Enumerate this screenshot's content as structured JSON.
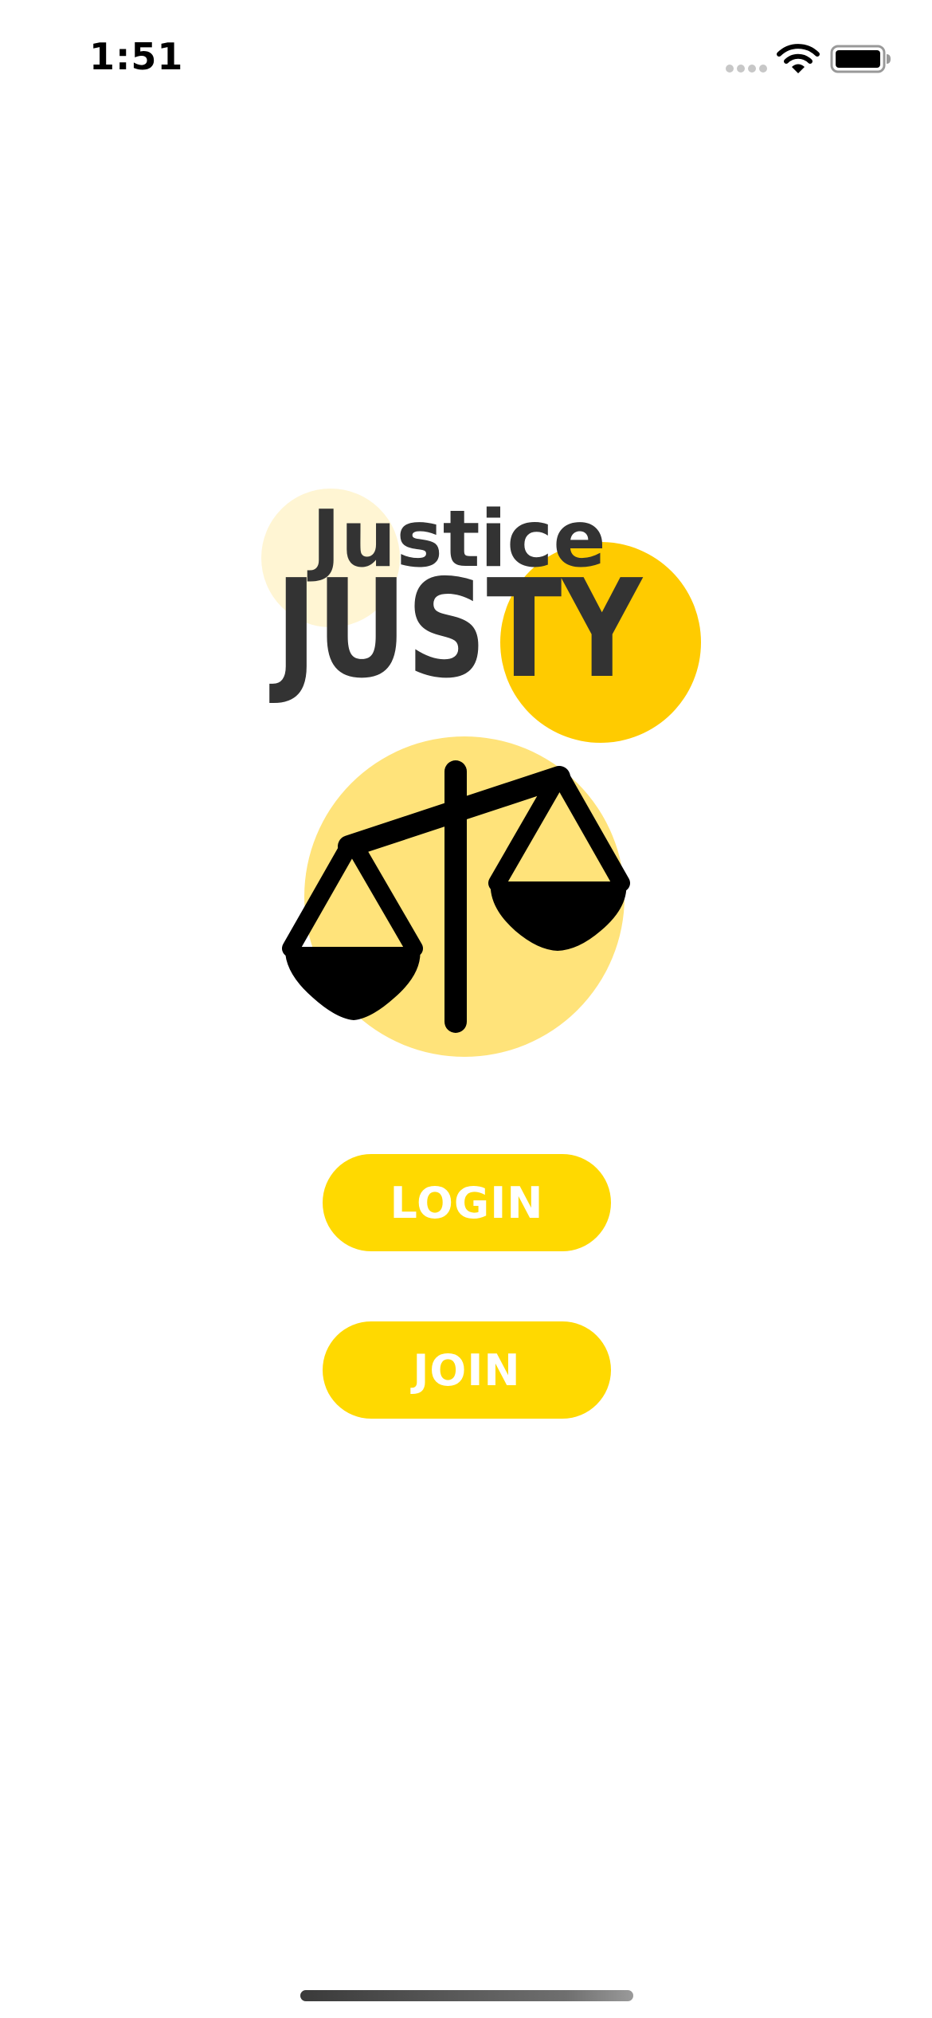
{
  "status_bar": {
    "time": "1:51",
    "signal_icon": "cellular-dots-icon",
    "wifi_icon": "wifi-icon",
    "battery_icon": "battery-icon"
  },
  "logo": {
    "small_word": "Justice",
    "brand_word": "JUSTY",
    "emblem_icon": "scales-of-justice-icon"
  },
  "actions": {
    "login_label": "LOGIN",
    "join_label": "JOIN"
  },
  "colors": {
    "button_yellow": "#FFD900",
    "circle_light": "#FFF5D3",
    "circle_gold": "#FFCB00",
    "circle_emblem": "#FFE37A",
    "logo_text": "#333333"
  }
}
